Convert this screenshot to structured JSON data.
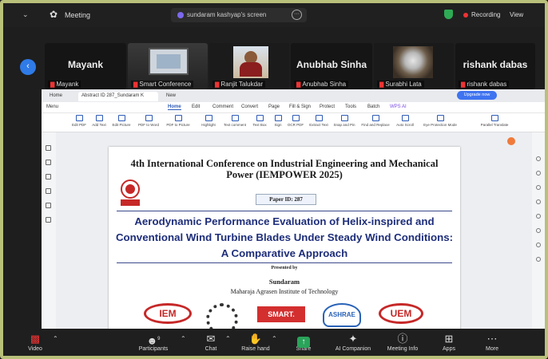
{
  "topbar": {
    "meeting_label": "Meeting",
    "tab_label": "sundaram kashyap's screen",
    "recording_label": "Recording",
    "view_label": "View"
  },
  "gallery": [
    {
      "big": "Mayank",
      "name": "Mayank"
    },
    {
      "big": "",
      "name": "Smart Conference"
    },
    {
      "big": "",
      "name": "Ranjit Talukdar"
    },
    {
      "big": "Anubhab Sinha",
      "name": "Anubhab Sinha"
    },
    {
      "big": "",
      "name": "Surabhi Lata"
    },
    {
      "big": "rishank dabas",
      "name": "rishank dabas"
    }
  ],
  "browser": {
    "tabs": [
      "Home",
      "Abstract ID 287_Sundaram K",
      "New"
    ],
    "menu": [
      "Menu",
      "Home",
      "Edit",
      "Comment",
      "Convert",
      "Page",
      "Fill & Sign",
      "Protect",
      "Tools",
      "Batch",
      "WPS AI"
    ],
    "upgrade": "Upgrade now",
    "ribbon": [
      "Edit PDF",
      "Add Text",
      "Edit Picture",
      "PDF to Word",
      "PDF to Picture",
      "Highlight",
      "Text comment",
      "Text Box",
      "Sign",
      "OCR PDF",
      "Extract Text",
      "Snap and Pin",
      "Find and Replace",
      "Auto Scroll",
      "Eye Protection Mode",
      "Parallel Translate"
    ]
  },
  "document": {
    "conference": "4th International Conference on Industrial Engineering and Mechanical Power (IEMPOWER 2025)",
    "paper_id": "Paper ID: 287",
    "title": "Aerodynamic Performance Evaluation of Helix-inspired and Conventional Wind Turbine Blades Under Steady Wind Conditions: A Comparative Approach",
    "presented_by": "Presented by",
    "author": "Sundaram",
    "institute": "Maharaja Agrasen Institute of Technology",
    "logos": [
      "IEM",
      "SMART.",
      "ASHRAE",
      "UEM"
    ],
    "mait": "MAIT"
  },
  "toolbar": {
    "participants_count": "9",
    "items": [
      "Video",
      "Participants",
      "Chat",
      "Raise hand",
      "Share",
      "AI Companion",
      "Meeting Info",
      "Apps",
      "More"
    ]
  },
  "colors": {
    "accent": "#2f7be8",
    "recording": "#e33333",
    "share": "#2aa35a",
    "title_blue": "#1e2e7a"
  }
}
